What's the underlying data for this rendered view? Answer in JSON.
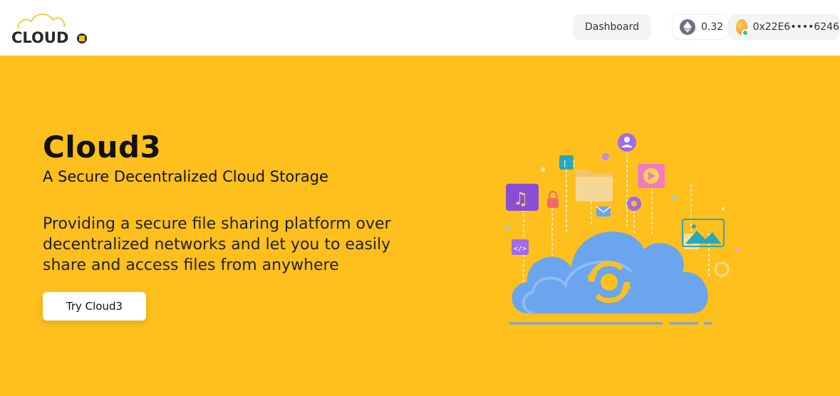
{
  "header": {
    "logo_text": "CLOUD",
    "nav": {
      "dashboard_label": "Dashboard"
    },
    "wallet": {
      "balance": "0.32",
      "currency_icon": "ethereum-icon",
      "address": "0x22E6••••6246"
    }
  },
  "hero": {
    "title": "Cloud3",
    "subtitle": "A Secure Decentralized Cloud Storage",
    "description": "Providing a secure file sharing platform over decentralized networks and let you to easily share and access files from anywhere",
    "cta_label": "Try Cloud3"
  },
  "theme": {
    "accent": "#ffc01d",
    "cloud_color": "#6aa5ee",
    "background": "#ffffff"
  }
}
